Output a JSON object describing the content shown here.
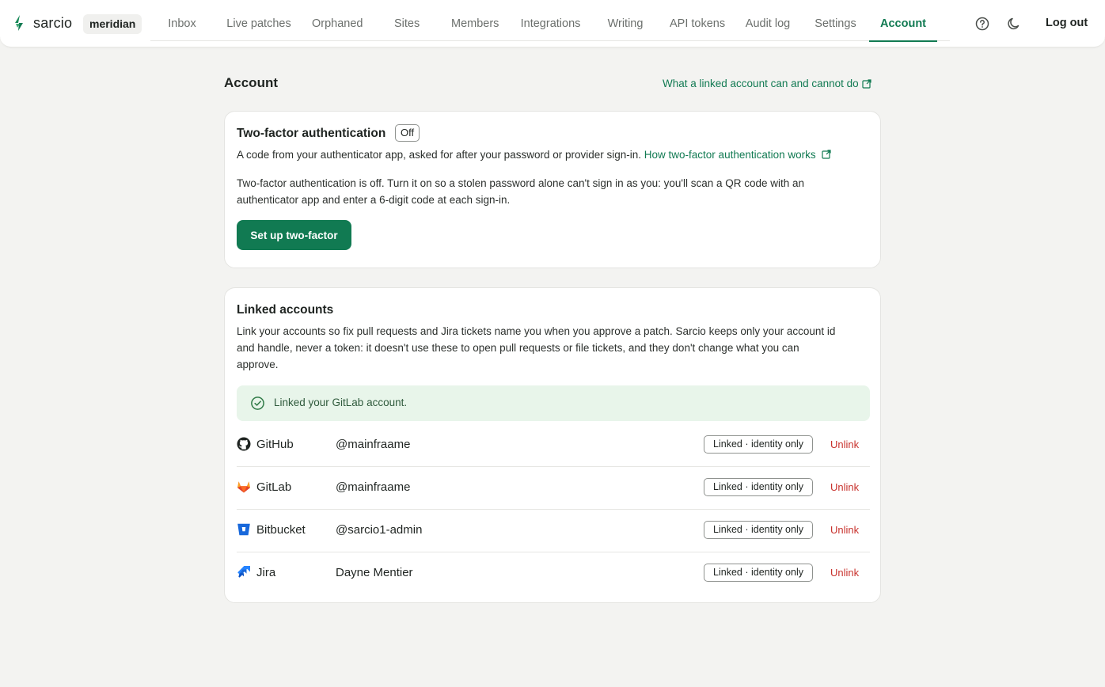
{
  "brand": {
    "name": "sarcio",
    "workspace": "meridian"
  },
  "nav": {
    "items": [
      "Inbox",
      "Live patches",
      "Orphaned",
      "Sites",
      "Members",
      "Integrations",
      "Writing",
      "API tokens",
      "Audit log",
      "Settings",
      "Account"
    ],
    "active": "Account",
    "help_icon": "help-circle-icon",
    "theme_icon": "moon-icon",
    "logout_label": "Log out"
  },
  "page": {
    "title": "Account",
    "help_link": "What a linked account can and cannot do"
  },
  "two_factor": {
    "title": "Two-factor authentication",
    "status": "Off",
    "description": "A code from your authenticator app, asked for after your password or provider sign-in.",
    "learn_link": "How two-factor authentication works",
    "body_line1": "Two-factor authentication is off. Turn it on so a stolen password alone can't sign in as you: you'll scan a QR code with an",
    "body_line2": "authenticator app and enter a 6-digit code at each sign-in.",
    "button_label": "Set up two-factor"
  },
  "linked_accounts": {
    "title": "Linked accounts",
    "line1": "Link your accounts so fix pull requests and Jira tickets name you when you approve a patch. Sarcio keeps only your account id",
    "line2": "and handle, never a token: it doesn't use these to open pull requests or file tickets, and they don't change what you can",
    "line3": "approve.",
    "alert": "Linked your GitLab account.",
    "accounts": [
      {
        "provider": "GitHub",
        "handle": "@mainfraame",
        "status": "Linked · identity only",
        "action": "Unlink",
        "icon": "github-icon"
      },
      {
        "provider": "GitLab",
        "handle": "@mainfraame",
        "status": "Linked · identity only",
        "action": "Unlink",
        "icon": "gitlab-icon"
      },
      {
        "provider": "Bitbucket",
        "handle": "@sarcio1-admin",
        "status": "Linked · identity only",
        "action": "Unlink",
        "icon": "bitbucket-icon"
      },
      {
        "provider": "Jira",
        "handle": "Dayne Mentier",
        "status": "Linked · identity only",
        "action": "Unlink",
        "icon": "jira-icon"
      }
    ]
  },
  "colors": {
    "accent": "#117a52",
    "danger": "#c8332e",
    "success_bg": "#e8f5ea",
    "page_bg": "#f3f3f1"
  }
}
